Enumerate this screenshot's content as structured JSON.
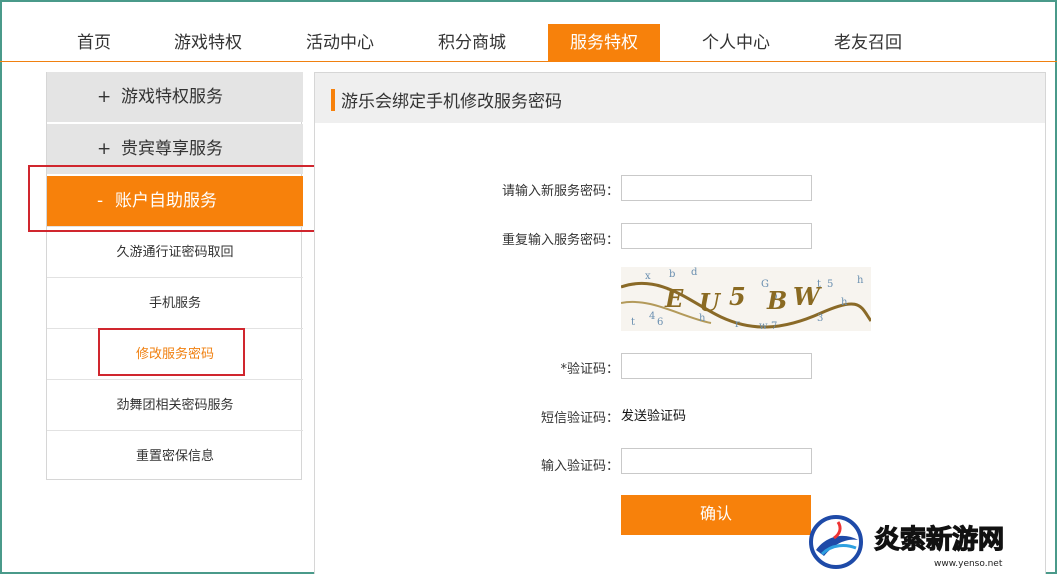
{
  "nav": {
    "items": [
      "首页",
      "游戏特权",
      "活动中心",
      "积分商城",
      "服务特权",
      "个人中心",
      "老友召回"
    ],
    "active": "服务特权"
  },
  "sidebar": {
    "sections": [
      {
        "sign": "+",
        "label": "游戏特权服务"
      },
      {
        "sign": "+",
        "label": "贵宾尊享服务"
      },
      {
        "sign": "-",
        "label": "账户自助服务"
      }
    ],
    "sub_items": [
      "久游通行证密码取回",
      "手机服务",
      "修改服务密码",
      "劲舞团相关密码服务",
      "重置密保信息"
    ],
    "current_sub": "修改服务密码"
  },
  "content": {
    "title": "游乐会绑定手机修改服务密码",
    "form": {
      "new_password_label": "请输入新服务密码：",
      "repeat_password_label": "重复输入服务密码：",
      "captcha_label": "*验证码：",
      "sms_label": "短信验证码：",
      "sms_link": "发送验证码",
      "input_code_label": "输入验证码：",
      "confirm_label": "确认"
    },
    "captcha_text": "EU5BW"
  },
  "watermark": {
    "name": "炎索新游网",
    "url": "www.yenso.net"
  },
  "colors": {
    "accent": "#f7810b",
    "highlight_box": "#d0262e",
    "frame": "#4a9a8a"
  }
}
